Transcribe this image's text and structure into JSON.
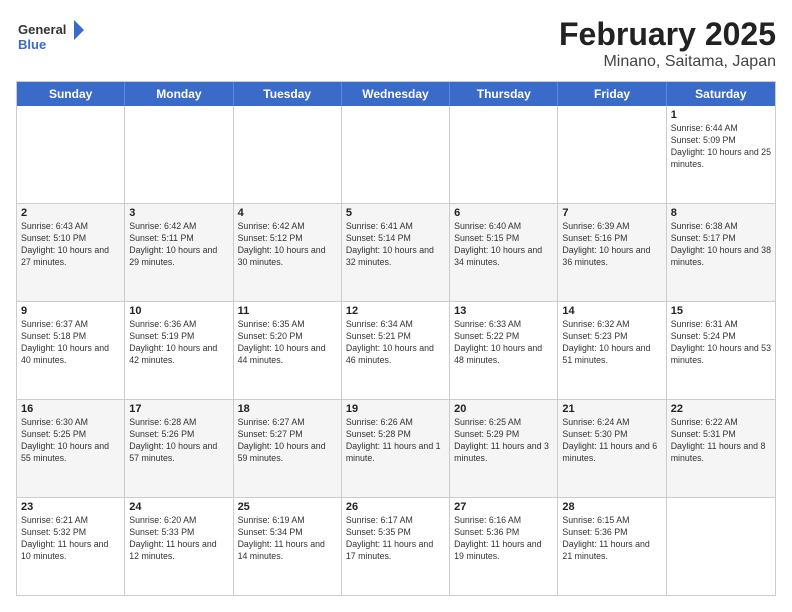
{
  "logo": {
    "line1": "General",
    "line2": "Blue"
  },
  "title": "February 2025",
  "subtitle": "Minano, Saitama, Japan",
  "days": [
    "Sunday",
    "Monday",
    "Tuesday",
    "Wednesday",
    "Thursday",
    "Friday",
    "Saturday"
  ],
  "weeks": [
    [
      {
        "day": "",
        "info": ""
      },
      {
        "day": "",
        "info": ""
      },
      {
        "day": "",
        "info": ""
      },
      {
        "day": "",
        "info": ""
      },
      {
        "day": "",
        "info": ""
      },
      {
        "day": "",
        "info": ""
      },
      {
        "day": "1",
        "info": "Sunrise: 6:44 AM\nSunset: 5:09 PM\nDaylight: 10 hours and 25 minutes."
      }
    ],
    [
      {
        "day": "2",
        "info": "Sunrise: 6:43 AM\nSunset: 5:10 PM\nDaylight: 10 hours and 27 minutes."
      },
      {
        "day": "3",
        "info": "Sunrise: 6:42 AM\nSunset: 5:11 PM\nDaylight: 10 hours and 29 minutes."
      },
      {
        "day": "4",
        "info": "Sunrise: 6:42 AM\nSunset: 5:12 PM\nDaylight: 10 hours and 30 minutes."
      },
      {
        "day": "5",
        "info": "Sunrise: 6:41 AM\nSunset: 5:14 PM\nDaylight: 10 hours and 32 minutes."
      },
      {
        "day": "6",
        "info": "Sunrise: 6:40 AM\nSunset: 5:15 PM\nDaylight: 10 hours and 34 minutes."
      },
      {
        "day": "7",
        "info": "Sunrise: 6:39 AM\nSunset: 5:16 PM\nDaylight: 10 hours and 36 minutes."
      },
      {
        "day": "8",
        "info": "Sunrise: 6:38 AM\nSunset: 5:17 PM\nDaylight: 10 hours and 38 minutes."
      }
    ],
    [
      {
        "day": "9",
        "info": "Sunrise: 6:37 AM\nSunset: 5:18 PM\nDaylight: 10 hours and 40 minutes."
      },
      {
        "day": "10",
        "info": "Sunrise: 6:36 AM\nSunset: 5:19 PM\nDaylight: 10 hours and 42 minutes."
      },
      {
        "day": "11",
        "info": "Sunrise: 6:35 AM\nSunset: 5:20 PM\nDaylight: 10 hours and 44 minutes."
      },
      {
        "day": "12",
        "info": "Sunrise: 6:34 AM\nSunset: 5:21 PM\nDaylight: 10 hours and 46 minutes."
      },
      {
        "day": "13",
        "info": "Sunrise: 6:33 AM\nSunset: 5:22 PM\nDaylight: 10 hours and 48 minutes."
      },
      {
        "day": "14",
        "info": "Sunrise: 6:32 AM\nSunset: 5:23 PM\nDaylight: 10 hours and 51 minutes."
      },
      {
        "day": "15",
        "info": "Sunrise: 6:31 AM\nSunset: 5:24 PM\nDaylight: 10 hours and 53 minutes."
      }
    ],
    [
      {
        "day": "16",
        "info": "Sunrise: 6:30 AM\nSunset: 5:25 PM\nDaylight: 10 hours and 55 minutes."
      },
      {
        "day": "17",
        "info": "Sunrise: 6:28 AM\nSunset: 5:26 PM\nDaylight: 10 hours and 57 minutes."
      },
      {
        "day": "18",
        "info": "Sunrise: 6:27 AM\nSunset: 5:27 PM\nDaylight: 10 hours and 59 minutes."
      },
      {
        "day": "19",
        "info": "Sunrise: 6:26 AM\nSunset: 5:28 PM\nDaylight: 11 hours and 1 minute."
      },
      {
        "day": "20",
        "info": "Sunrise: 6:25 AM\nSunset: 5:29 PM\nDaylight: 11 hours and 3 minutes."
      },
      {
        "day": "21",
        "info": "Sunrise: 6:24 AM\nSunset: 5:30 PM\nDaylight: 11 hours and 6 minutes."
      },
      {
        "day": "22",
        "info": "Sunrise: 6:22 AM\nSunset: 5:31 PM\nDaylight: 11 hours and 8 minutes."
      }
    ],
    [
      {
        "day": "23",
        "info": "Sunrise: 6:21 AM\nSunset: 5:32 PM\nDaylight: 11 hours and 10 minutes."
      },
      {
        "day": "24",
        "info": "Sunrise: 6:20 AM\nSunset: 5:33 PM\nDaylight: 11 hours and 12 minutes."
      },
      {
        "day": "25",
        "info": "Sunrise: 6:19 AM\nSunset: 5:34 PM\nDaylight: 11 hours and 14 minutes."
      },
      {
        "day": "26",
        "info": "Sunrise: 6:17 AM\nSunset: 5:35 PM\nDaylight: 11 hours and 17 minutes."
      },
      {
        "day": "27",
        "info": "Sunrise: 6:16 AM\nSunset: 5:36 PM\nDaylight: 11 hours and 19 minutes."
      },
      {
        "day": "28",
        "info": "Sunrise: 6:15 AM\nSunset: 5:36 PM\nDaylight: 11 hours and 21 minutes."
      },
      {
        "day": "",
        "info": ""
      }
    ]
  ]
}
